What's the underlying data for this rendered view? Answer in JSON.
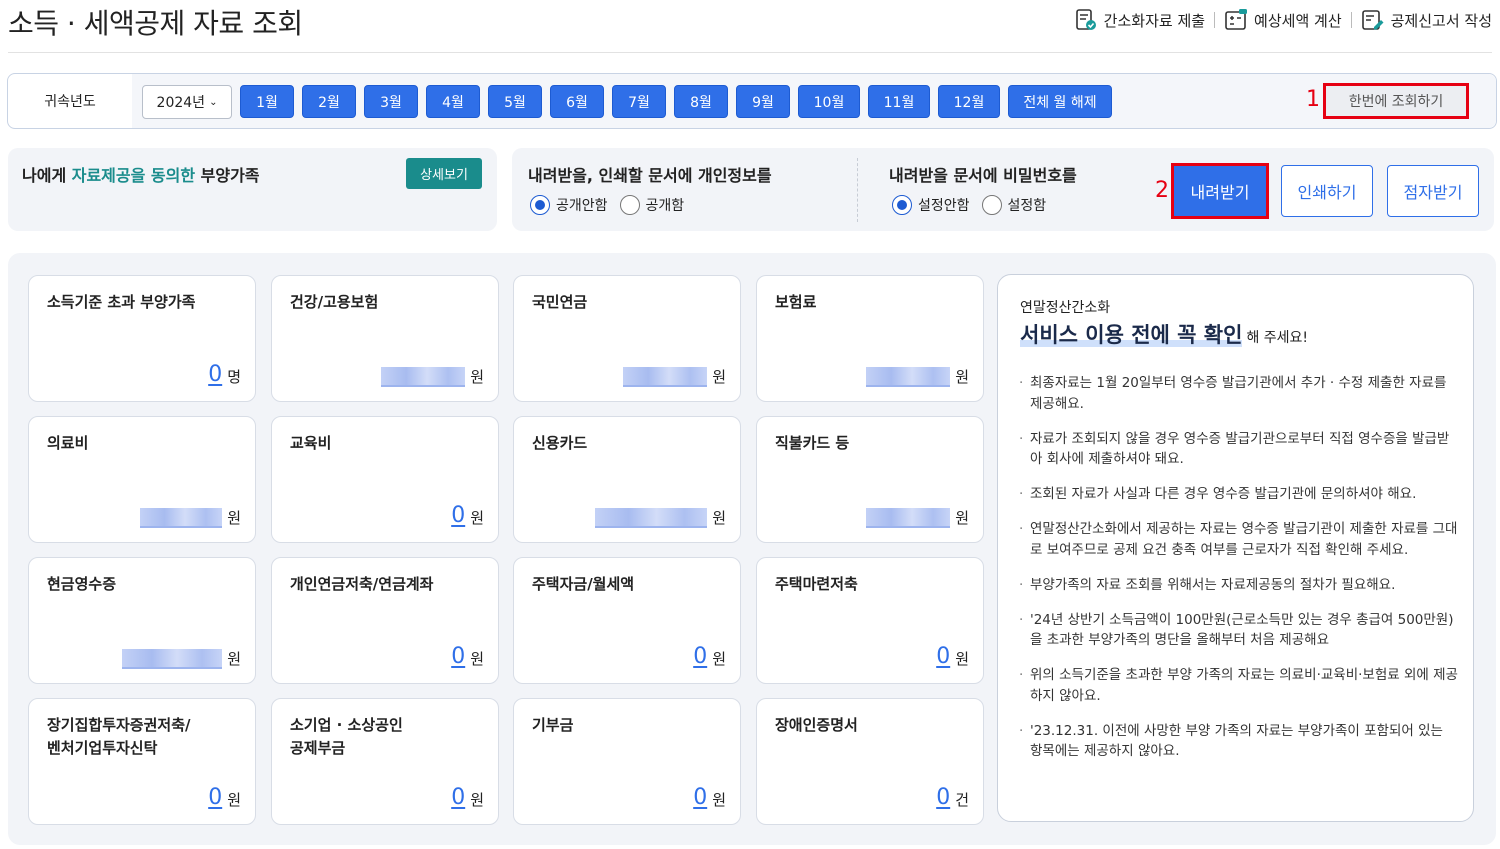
{
  "page": {
    "title": "소득 · 세액공제 자료 조회",
    "links": [
      "간소화자료 제출",
      "예상세액 계산",
      "공제신고서 작성"
    ]
  },
  "yearbar": {
    "label": "귀속년도",
    "year": "2024년",
    "months": [
      "1월",
      "2월",
      "3월",
      "4월",
      "5월",
      "6월",
      "7월",
      "8월",
      "9월",
      "10월",
      "11월",
      "12월",
      "전체 월 해제"
    ],
    "query_all": "한번에 조회하기",
    "marker1": "1"
  },
  "consent": {
    "prefix": "나에게 ",
    "highlight": "자료제공을 동의한",
    "suffix": " 부양가족",
    "detail_button": "상세보기"
  },
  "options": {
    "privacy_title": "내려받을, 인쇄할 문서에 개인정보를",
    "privacy_options": [
      "공개안함",
      "공개함"
    ],
    "privacy_selected": "공개안함",
    "password_title": "내려받을 문서에 비밀번호를",
    "password_options": [
      "설정안함",
      "설정함"
    ],
    "password_selected": "설정안함",
    "marker2": "2",
    "download": "내려받기",
    "print": "인쇄하기",
    "braille": "점자받기"
  },
  "cards": [
    {
      "title": "소득기준 초과 부양가족",
      "value": "0",
      "unit": "명",
      "masked": false
    },
    {
      "title": "건강/고용보험",
      "value": "",
      "unit": "원",
      "masked": true
    },
    {
      "title": "국민연금",
      "value": "",
      "unit": "원",
      "masked": true
    },
    {
      "title": "보험료",
      "value": "",
      "unit": "원",
      "masked": true
    },
    {
      "title": "의료비",
      "value": "",
      "unit": "원",
      "masked": true
    },
    {
      "title": "교육비",
      "value": "0",
      "unit": "원",
      "masked": false
    },
    {
      "title": "신용카드",
      "value": "",
      "unit": "원",
      "masked": true
    },
    {
      "title": "직불카드 등",
      "value": "",
      "unit": "원",
      "masked": true
    },
    {
      "title": "현금영수증",
      "value": "",
      "unit": "원",
      "masked": true
    },
    {
      "title": "개인연금저축/연금계좌",
      "value": "0",
      "unit": "원",
      "masked": false
    },
    {
      "title": "주택자금/월세액",
      "value": "0",
      "unit": "원",
      "masked": false
    },
    {
      "title": "주택마련저축",
      "value": "0",
      "unit": "원",
      "masked": false
    },
    {
      "title": "장기집합투자증권저축/\n벤처기업투자신탁",
      "value": "0",
      "unit": "원",
      "masked": false
    },
    {
      "title": "소기업 · 소상공인\n공제부금",
      "value": "0",
      "unit": "원",
      "masked": false
    },
    {
      "title": "기부금",
      "value": "0",
      "unit": "원",
      "masked": false
    },
    {
      "title": "장애인증명서",
      "value": "0",
      "unit": "건",
      "masked": false
    }
  ],
  "notice": {
    "subtitle": "연말정산간소화",
    "heading": "서비스 이용 전에 꼭 확인",
    "heading_suffix": "해 주세요!",
    "bullets": [
      "최종자료는 1월 20일부터 영수증 발급기관에서 추가 · 수정 제출한 자료를 제공해요.",
      "자료가 조회되지 않을 경우 영수증 발급기관으로부터 직접 영수증을 발급받아 회사에 제출하셔야 돼요.",
      "조회된 자료가 사실과 다른 경우 영수증 발급기관에 문의하셔야 해요.",
      "연말정산간소화에서 제공하는 자료는 영수증 발급기관이 제출한 자료를 그대로 보여주므로 공제 요건 충족 여부를 근로자가 직접 확인해 주세요.",
      "부양가족의 자료 조회를 위해서는 자료제공동의 절차가 필요해요.",
      "'24년 상반기 소득금액이 100만원(근로소득만 있는 경우 총급여 500만원)을 초과한 부양가족의 명단을 올해부터 처음 제공해요",
      "위의 소득기준을 초과한 부양 가족의 자료는 의료비·교육비·보험료 외에 제공하지 않아요.",
      "'23.12.31. 이전에 사망한 부양 가족의 자료는 부양가족이 포함되어 있는 항목에는 제공하지 않아요."
    ]
  }
}
